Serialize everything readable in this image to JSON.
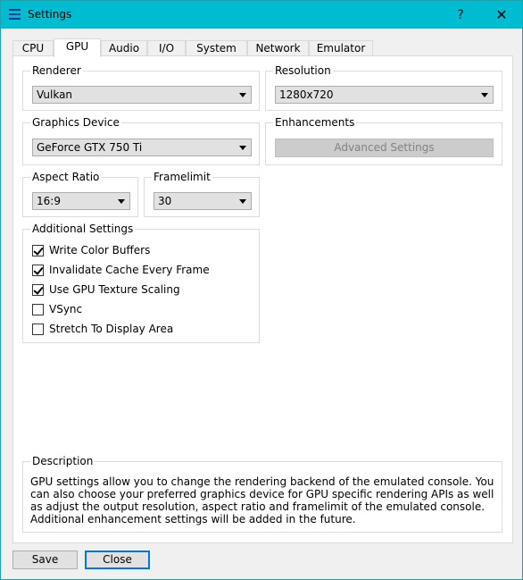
{
  "window": {
    "title": "Settings",
    "help_glyph": "?",
    "close_glyph": "✕"
  },
  "tabs": [
    "CPU",
    "GPU",
    "Audio",
    "I/O",
    "System",
    "Network",
    "Emulator"
  ],
  "active_tab": "GPU",
  "renderer": {
    "label": "Renderer",
    "value": "Vulkan"
  },
  "resolution": {
    "label": "Resolution",
    "value": "1280x720"
  },
  "graphics_device": {
    "label": "Graphics Device",
    "value": "GeForce GTX 750 Ti"
  },
  "enhancements": {
    "label": "Enhancements",
    "button": "Advanced Settings"
  },
  "aspect_ratio": {
    "label": "Aspect Ratio",
    "value": "16:9"
  },
  "framelimit": {
    "label": "Framelimit",
    "value": "30"
  },
  "additional": {
    "label": "Additional Settings",
    "options": [
      {
        "label": "Write Color Buffers",
        "checked": true
      },
      {
        "label": "Invalidate Cache Every Frame",
        "checked": true
      },
      {
        "label": "Use GPU Texture Scaling",
        "checked": true
      },
      {
        "label": "VSync",
        "checked": false
      },
      {
        "label": "Stretch To Display Area",
        "checked": false
      }
    ]
  },
  "description": {
    "label": "Description",
    "text": "GPU settings allow you to change the rendering backend of the emulated console. You can also choose your preferred graphics device for GPU specific rendering APIs as well as adjust the output resolution, aspect ratio and framelimit of the emulated console. Additional enhancement settings will be added in the future."
  },
  "buttons": {
    "save": "Save",
    "close": "Close"
  },
  "colors": {
    "titlebar": "#00bcd0",
    "accent": "#0078d7"
  }
}
